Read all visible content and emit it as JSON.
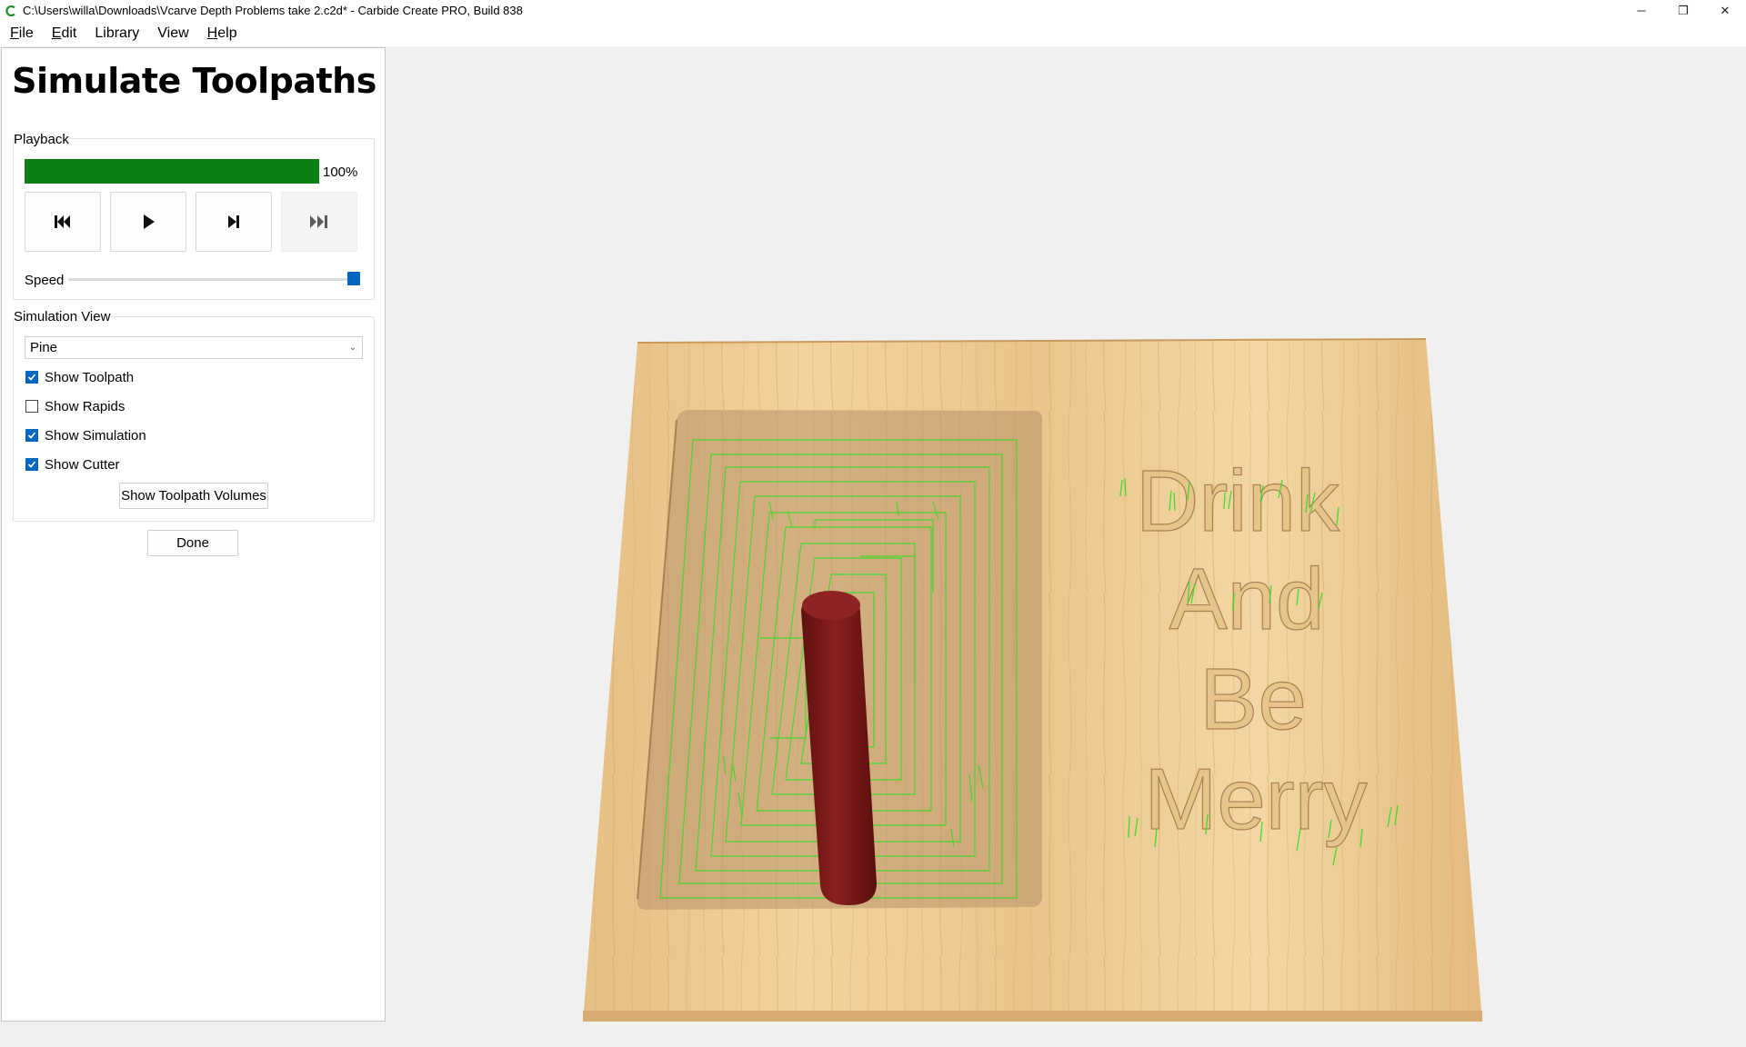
{
  "window": {
    "title": "C:\\Users\\willa\\Downloads\\Vcarve Depth Problems take 2.c2d* - Carbide Create PRO, Build 838",
    "controls": {
      "minimize": "─",
      "restore": "❐",
      "close": "✕"
    },
    "app_icon": "carbide-create-icon"
  },
  "menu": [
    {
      "label_ul": "F",
      "label_rest": "ile"
    },
    {
      "label_ul": "E",
      "label_rest": "dit"
    },
    {
      "label_ul": "",
      "label_rest": "Library"
    },
    {
      "label_ul": "",
      "label_rest": "View"
    },
    {
      "label_ul": "H",
      "label_rest": "elp"
    }
  ],
  "panel": {
    "title": "Simulate Toolpaths",
    "playback": {
      "label": "Playback",
      "progress": 100,
      "progress_text": "100%",
      "progress_color": "#0d7f16",
      "buttons": [
        {
          "name": "rewind-button",
          "icon": "skip-to-start-icon",
          "enabled": true
        },
        {
          "name": "play-button",
          "icon": "play-icon",
          "enabled": true
        },
        {
          "name": "step-forward-button",
          "icon": "step-forward-icon",
          "enabled": true
        },
        {
          "name": "skip-to-end-button",
          "icon": "skip-to-end-icon",
          "enabled": false
        }
      ],
      "speed_label": "Speed",
      "speed": 1.0
    },
    "simulation_view": {
      "label": "Simulation View",
      "material": "Pine",
      "checkboxes": [
        {
          "label": "Show Toolpath",
          "checked": true
        },
        {
          "label": "Show Rapids",
          "checked": false
        },
        {
          "label": "Show Simulation",
          "checked": true
        },
        {
          "label": "Show Cutter",
          "checked": true
        }
      ],
      "volumes_button": "Show Toolpath Volumes"
    },
    "done_button": "Done"
  },
  "viewport": {
    "engraved_lines": [
      "Drink",
      "And",
      "Be",
      "Merry"
    ],
    "colors": {
      "wood_light": "#f1d199",
      "wood_dark": "#d9a865",
      "pocket": "#c9a77c",
      "toolpath": "#33dd22",
      "cutter": "#7a1a1a",
      "accent": "#0067c0"
    }
  }
}
